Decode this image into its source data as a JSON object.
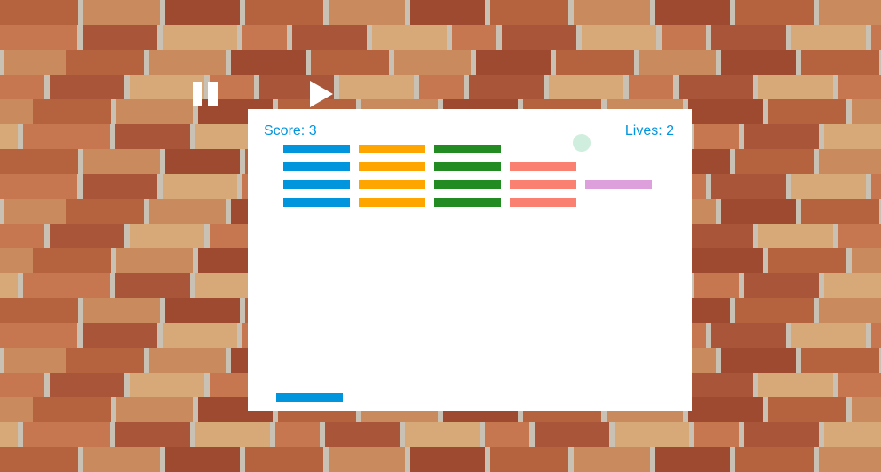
{
  "hud": {
    "score_text": "Score: 3",
    "lives_text": "Lives: 2"
  },
  "controls": {
    "pause_icon": "pause-icon",
    "play_icon": "play-icon"
  },
  "colors": {
    "hud_text": "#0095dd",
    "paddle": "#0095dd",
    "ball": "#cfeedd",
    "falling_brick": "#dda0dd",
    "columns": [
      "#0095dd",
      "#ffa500",
      "#228b22",
      "#fa8072"
    ]
  },
  "bricks": {
    "rows": 4,
    "columns": 4,
    "present": [
      [
        true,
        true,
        true,
        false
      ],
      [
        true,
        true,
        true,
        true
      ],
      [
        true,
        true,
        true,
        true
      ],
      [
        true,
        true,
        true,
        true
      ]
    ]
  }
}
